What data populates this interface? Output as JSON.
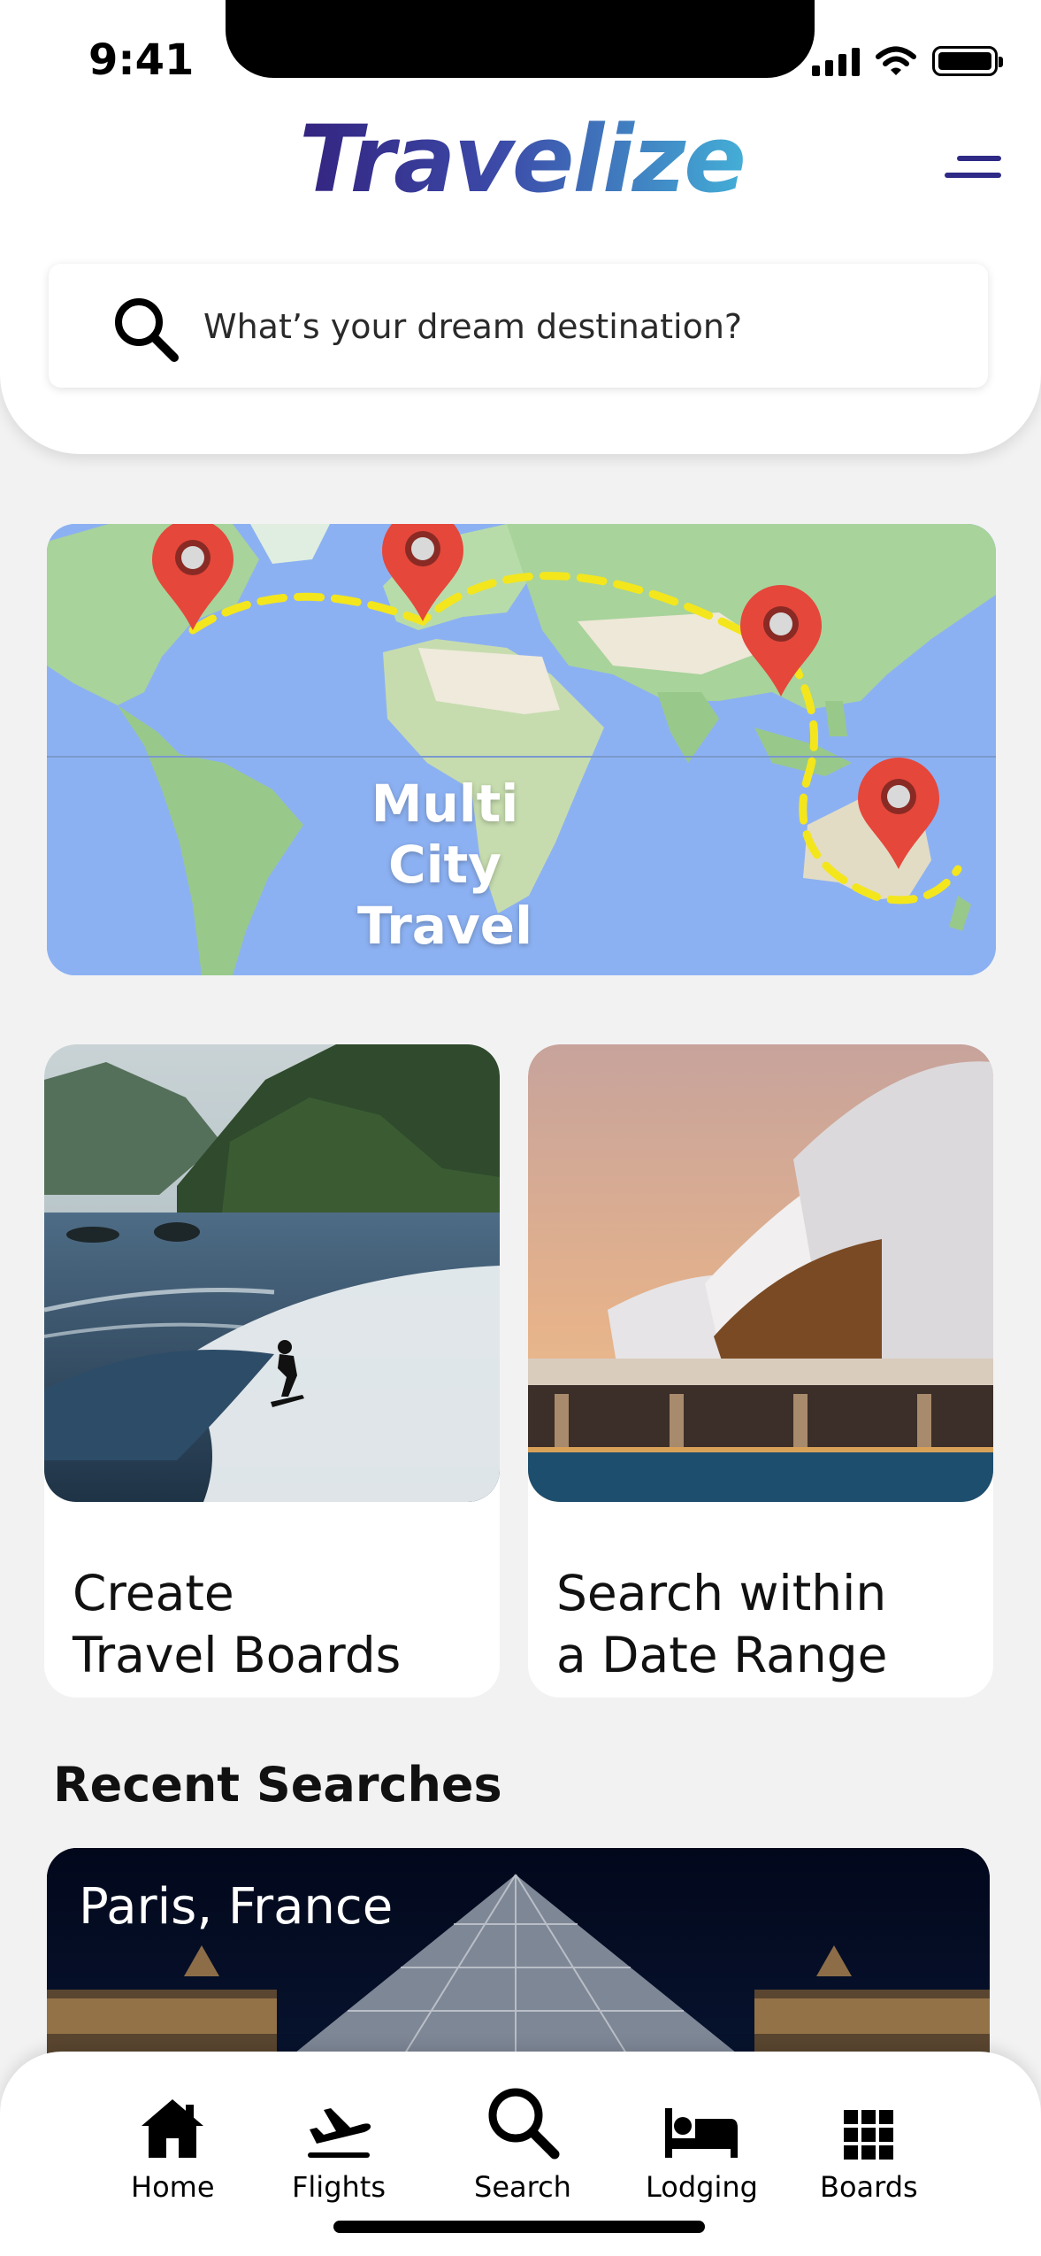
{
  "status_bar": {
    "time": "9:41"
  },
  "header": {
    "logo": "Travelize",
    "search_placeholder": "What’s your dream destination?"
  },
  "map_card": {
    "title_lines": [
      "Multi",
      "City",
      "Travel"
    ]
  },
  "feature_cards": [
    {
      "lines": [
        "Create",
        "Travel Boards"
      ]
    },
    {
      "lines": [
        "Search within",
        "a Date Range"
      ]
    }
  ],
  "recent": {
    "heading": "Recent Searches",
    "items": [
      {
        "place": "Paris, France"
      }
    ]
  },
  "nav": {
    "items": [
      {
        "label": "Home",
        "icon": "home-icon"
      },
      {
        "label": "Flights",
        "icon": "flight-icon"
      },
      {
        "label": "Search",
        "icon": "search-icon"
      },
      {
        "label": "Lodging",
        "icon": "bed-icon"
      },
      {
        "label": "Boards",
        "icon": "grid-icon"
      }
    ]
  },
  "colors": {
    "brand_dark": "#33227e",
    "brand_light": "#44b1d8",
    "map_water": "#8cb1f2",
    "pin": "#e5473b",
    "route": "#f4e61c"
  }
}
